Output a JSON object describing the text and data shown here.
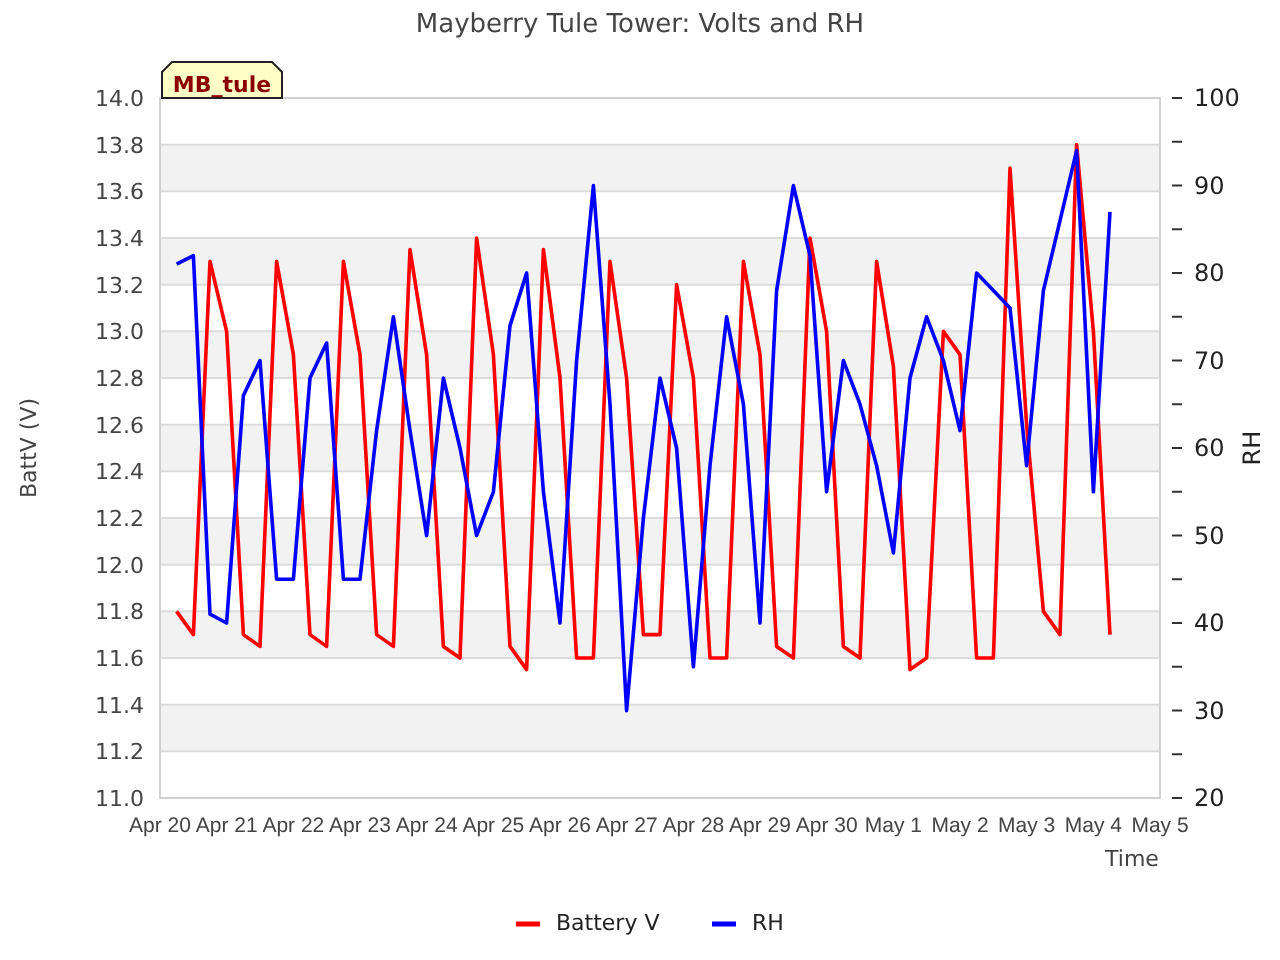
{
  "badge": "MB_tule",
  "chart_data": {
    "type": "line",
    "title": "Mayberry Tule Tower: Volts and RH",
    "xlabel": "Time",
    "ylabel": "BattV (V)",
    "y2label": "RH",
    "grid": true,
    "legend": true,
    "ylim": [
      11,
      14
    ],
    "y2lim": [
      20,
      100
    ],
    "categories": [
      "Apr 20",
      null,
      null,
      null,
      "Apr 21",
      null,
      null,
      null,
      "Apr 22",
      null,
      null,
      null,
      "Apr 23",
      null,
      null,
      null,
      "Apr 24",
      null,
      null,
      null,
      "Apr 25",
      null,
      null,
      null,
      "Apr 26",
      null,
      null,
      null,
      "Apr 27",
      null,
      null,
      null,
      "Apr 28",
      null,
      null,
      null,
      "Apr 29",
      null,
      null,
      null,
      "Apr 30",
      null,
      null,
      null,
      "May 1",
      null,
      null,
      null,
      "May 2",
      null,
      null,
      null,
      "May 3",
      null,
      null,
      null,
      "May 4",
      null,
      null,
      null,
      "May 5"
    ],
    "yticks": [
      {
        "value": 11,
        "label": "11.0"
      },
      {
        "value": 11.2,
        "label": "11.2"
      },
      {
        "value": 11.4,
        "label": "11.4"
      },
      {
        "value": 11.6,
        "label": "11.6"
      },
      {
        "value": 11.8,
        "label": "11.8"
      },
      {
        "value": 12,
        "label": "12.0"
      },
      {
        "value": 12.2,
        "label": "12.2"
      },
      {
        "value": 12.4,
        "label": "12.4"
      },
      {
        "value": 12.6,
        "label": "12.6"
      },
      {
        "value": 12.8,
        "label": "12.8"
      },
      {
        "value": 13,
        "label": "13.0"
      },
      {
        "value": 13.2,
        "label": "13.2"
      },
      {
        "value": 13.4,
        "label": "13.4"
      },
      {
        "value": 13.6,
        "label": "13.6"
      },
      {
        "value": 13.8,
        "label": "13.8"
      },
      {
        "value": 14,
        "label": "14.0"
      }
    ],
    "y2ticks": [
      20,
      30,
      40,
      50,
      60,
      70,
      80,
      90,
      100
    ],
    "series": [
      {
        "name": "Battery V",
        "color": "#ff0000",
        "values": [
          null,
          11.8,
          11.7,
          13.3,
          13.0,
          11.7,
          11.65,
          13.3,
          12.9,
          11.7,
          11.65,
          13.3,
          12.9,
          11.7,
          11.65,
          13.35,
          12.9,
          11.65,
          11.6,
          13.4,
          12.9,
          11.65,
          11.55,
          13.35,
          12.8,
          11.6,
          11.6,
          13.3,
          12.8,
          11.7,
          11.7,
          13.2,
          12.8,
          11.6,
          11.6,
          13.3,
          12.9,
          11.65,
          11.6,
          13.4,
          13.0,
          11.65,
          11.6,
          13.3,
          12.85,
          11.55,
          11.6,
          13.0,
          12.9,
          11.6,
          11.6,
          13.7,
          12.6,
          11.8,
          11.7,
          13.8,
          13.0,
          11.7,
          null,
          null,
          null
        ]
      },
      {
        "name": "RH",
        "color": "#0000ff",
        "axis": "y2",
        "values": [
          null,
          81,
          82,
          41,
          40,
          66,
          70,
          45,
          45,
          68,
          72,
          45,
          45,
          62,
          75,
          62,
          50,
          68,
          60,
          50,
          55,
          74,
          80,
          55,
          40,
          70,
          90,
          65,
          30,
          52,
          68,
          60,
          35,
          58,
          75,
          65,
          40,
          78,
          90,
          82,
          55,
          70,
          65,
          58,
          48,
          68,
          75,
          70,
          62,
          80,
          78,
          76,
          58,
          78,
          86,
          94,
          55,
          87,
          null,
          null,
          null
        ]
      }
    ]
  }
}
